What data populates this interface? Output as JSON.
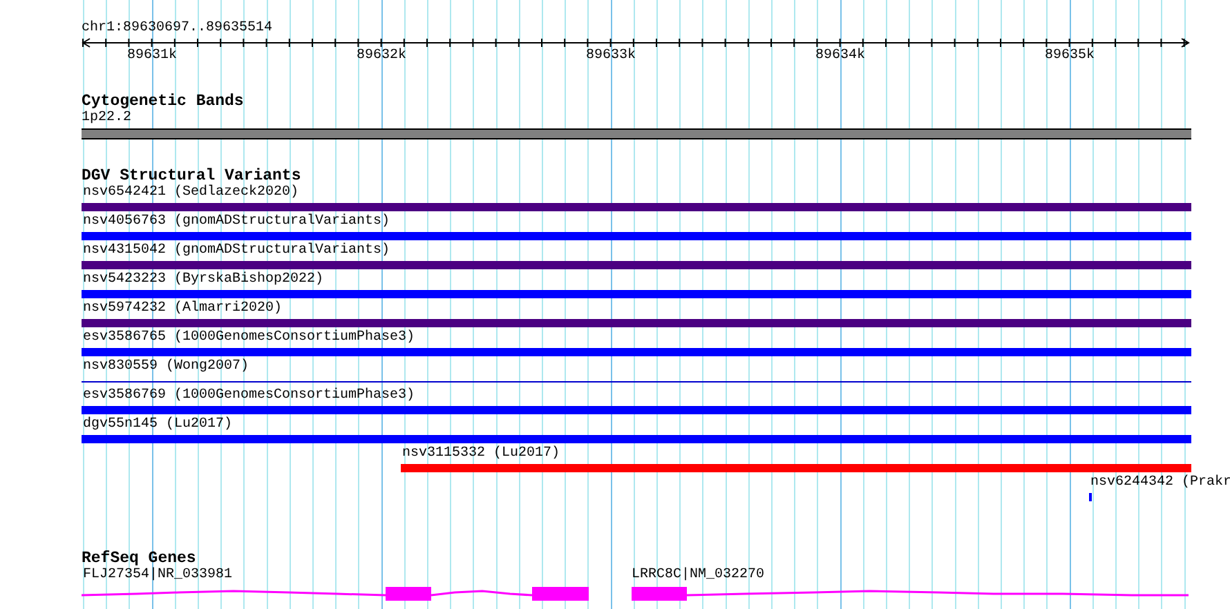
{
  "ruler": {
    "location": "chr1:89630697..89635514",
    "ticks": [
      "89631k",
      "89632k",
      "89633k",
      "89634k",
      "89635k"
    ]
  },
  "tracks": [
    {
      "kind": "bands",
      "title": "Cytogenetic Bands",
      "features": [
        {
          "label": "1p22.2",
          "color": "#808080"
        }
      ]
    },
    {
      "kind": "variants",
      "title": "DGV Structural Variants",
      "features": [
        {
          "label": "nsv6542421 (Sedlazeck2020)",
          "kind": "bar",
          "color": "#4b0082"
        },
        {
          "label": "nsv4056763 (gnomADStructuralVariants)",
          "kind": "bar",
          "color": "#0000ff"
        },
        {
          "label": "nsv4315042 (gnomADStructuralVariants)",
          "kind": "bar",
          "color": "#4b0082"
        },
        {
          "label": "nsv5423223 (ByrskaBishop2022)",
          "kind": "bar",
          "color": "#0000ff"
        },
        {
          "label": "nsv5974232 (Almarri2020)",
          "kind": "bar",
          "color": "#4b0082"
        },
        {
          "label": "esv3586765 (1000GenomesConsortiumPhase3)",
          "kind": "bar",
          "color": "#0000ff"
        },
        {
          "label": "nsv830559 (Wong2007)",
          "kind": "line",
          "color": "#0000cd"
        },
        {
          "label": "esv3586769 (1000GenomesConsortiumPhase3)",
          "kind": "bar",
          "color": "#0000ff"
        },
        {
          "label": "dgv55n145 (Lu2017)",
          "kind": "bar",
          "color": "#0000ff"
        },
        {
          "label": "nsv3115332 (Lu2017)",
          "kind": "bar",
          "color": "#ff0000"
        },
        {
          "label": "nsv6244342 (Prakr",
          "kind": "bar",
          "color": "#0000ff"
        }
      ]
    },
    {
      "kind": "genes",
      "title": "RefSeq Genes",
      "features": [
        {
          "label": "FLJ27354|NR_033981",
          "color": "#ff00ff"
        },
        {
          "label": "LRRC8C|NM_032270",
          "color": "#ff00ff"
        }
      ]
    }
  ]
}
